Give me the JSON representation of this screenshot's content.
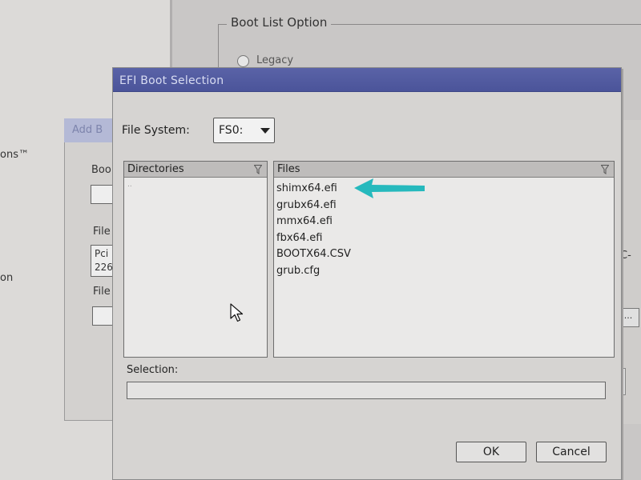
{
  "background": {
    "left_texts": [
      "ons™",
      "on"
    ],
    "boot_list_option": {
      "title": "Boot List Option",
      "legacy_label": "Legacy"
    },
    "add_dialog": {
      "title": "Add B",
      "boot_label": "Boo",
      "file_system_label": "File",
      "file_system_lines": [
        "Pci",
        "226"
      ],
      "file_name_label": "File"
    },
    "right_fragment": "C-",
    "browse_button": "..."
  },
  "dialog": {
    "title": "EFI Boot Selection",
    "file_system_label": "File System:",
    "file_system_value": "FS0:",
    "directories_header": "Directories",
    "directories": [
      ".."
    ],
    "files_header": "Files",
    "files": [
      "shimx64.efi",
      "grubx64.efi",
      "mmx64.efi",
      "fbx64.efi",
      "BOOTX64.CSV",
      "grub.cfg"
    ],
    "selection_label": "Selection:",
    "selection_value": "",
    "ok_label": "OK",
    "cancel_label": "Cancel"
  },
  "colors": {
    "title_bar": "#5056a0",
    "dialog_bg": "#d6d4d2",
    "annotation_arrow": "#26b9bd"
  },
  "icons": {
    "filter": "funnel-icon",
    "dropdown": "chevron-down-icon",
    "pointer": "mouse-pointer-icon",
    "annotation": "arrow-left-icon"
  }
}
